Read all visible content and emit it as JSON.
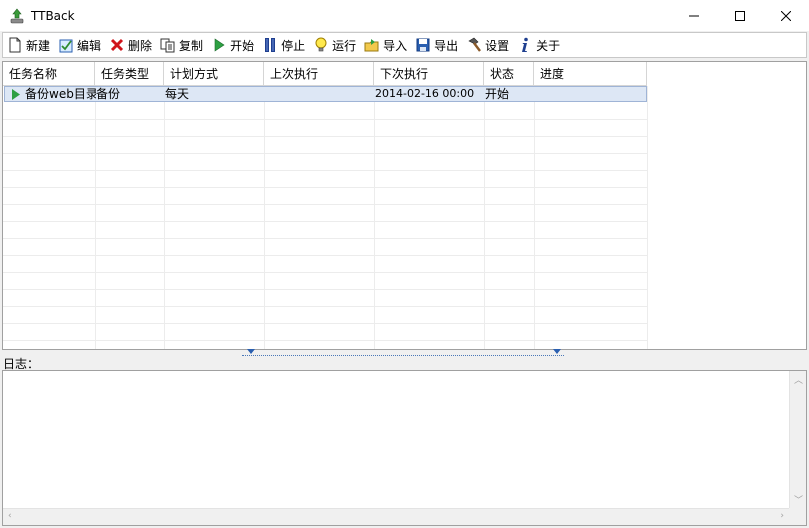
{
  "window": {
    "title": "TTBack"
  },
  "toolbar": [
    {
      "label": "新建",
      "icon": "new-file-icon"
    },
    {
      "label": "编辑",
      "icon": "edit-check-icon"
    },
    {
      "label": "删除",
      "icon": "delete-x-icon"
    },
    {
      "label": "复制",
      "icon": "copy-icon"
    },
    {
      "label": "开始",
      "icon": "play-icon"
    },
    {
      "label": "停止",
      "icon": "stop-bars-icon"
    },
    {
      "label": "运行",
      "icon": "lightbulb-icon"
    },
    {
      "label": "导入",
      "icon": "import-folder-icon"
    },
    {
      "label": "导出",
      "icon": "save-disk-icon"
    },
    {
      "label": "设置",
      "icon": "hammer-icon"
    },
    {
      "label": "关于",
      "icon": "info-icon"
    }
  ],
  "table": {
    "columns": [
      "任务名称",
      "任务类型",
      "计划方式",
      "上次执行",
      "下次执行",
      "状态",
      "进度"
    ],
    "rows": [
      {
        "name": "备份web目录",
        "type": "备份",
        "schedule": "每天",
        "last_run": "",
        "next_run": "2014-02-16 00:00",
        "status": "开始",
        "progress": ""
      }
    ]
  },
  "log": {
    "label": "日志：",
    "content": ""
  },
  "colors": {
    "selection": "#dde7f5",
    "play_green": "#2ea043",
    "delete_red": "#d0141b",
    "accent_blue": "#2a5fb0"
  }
}
